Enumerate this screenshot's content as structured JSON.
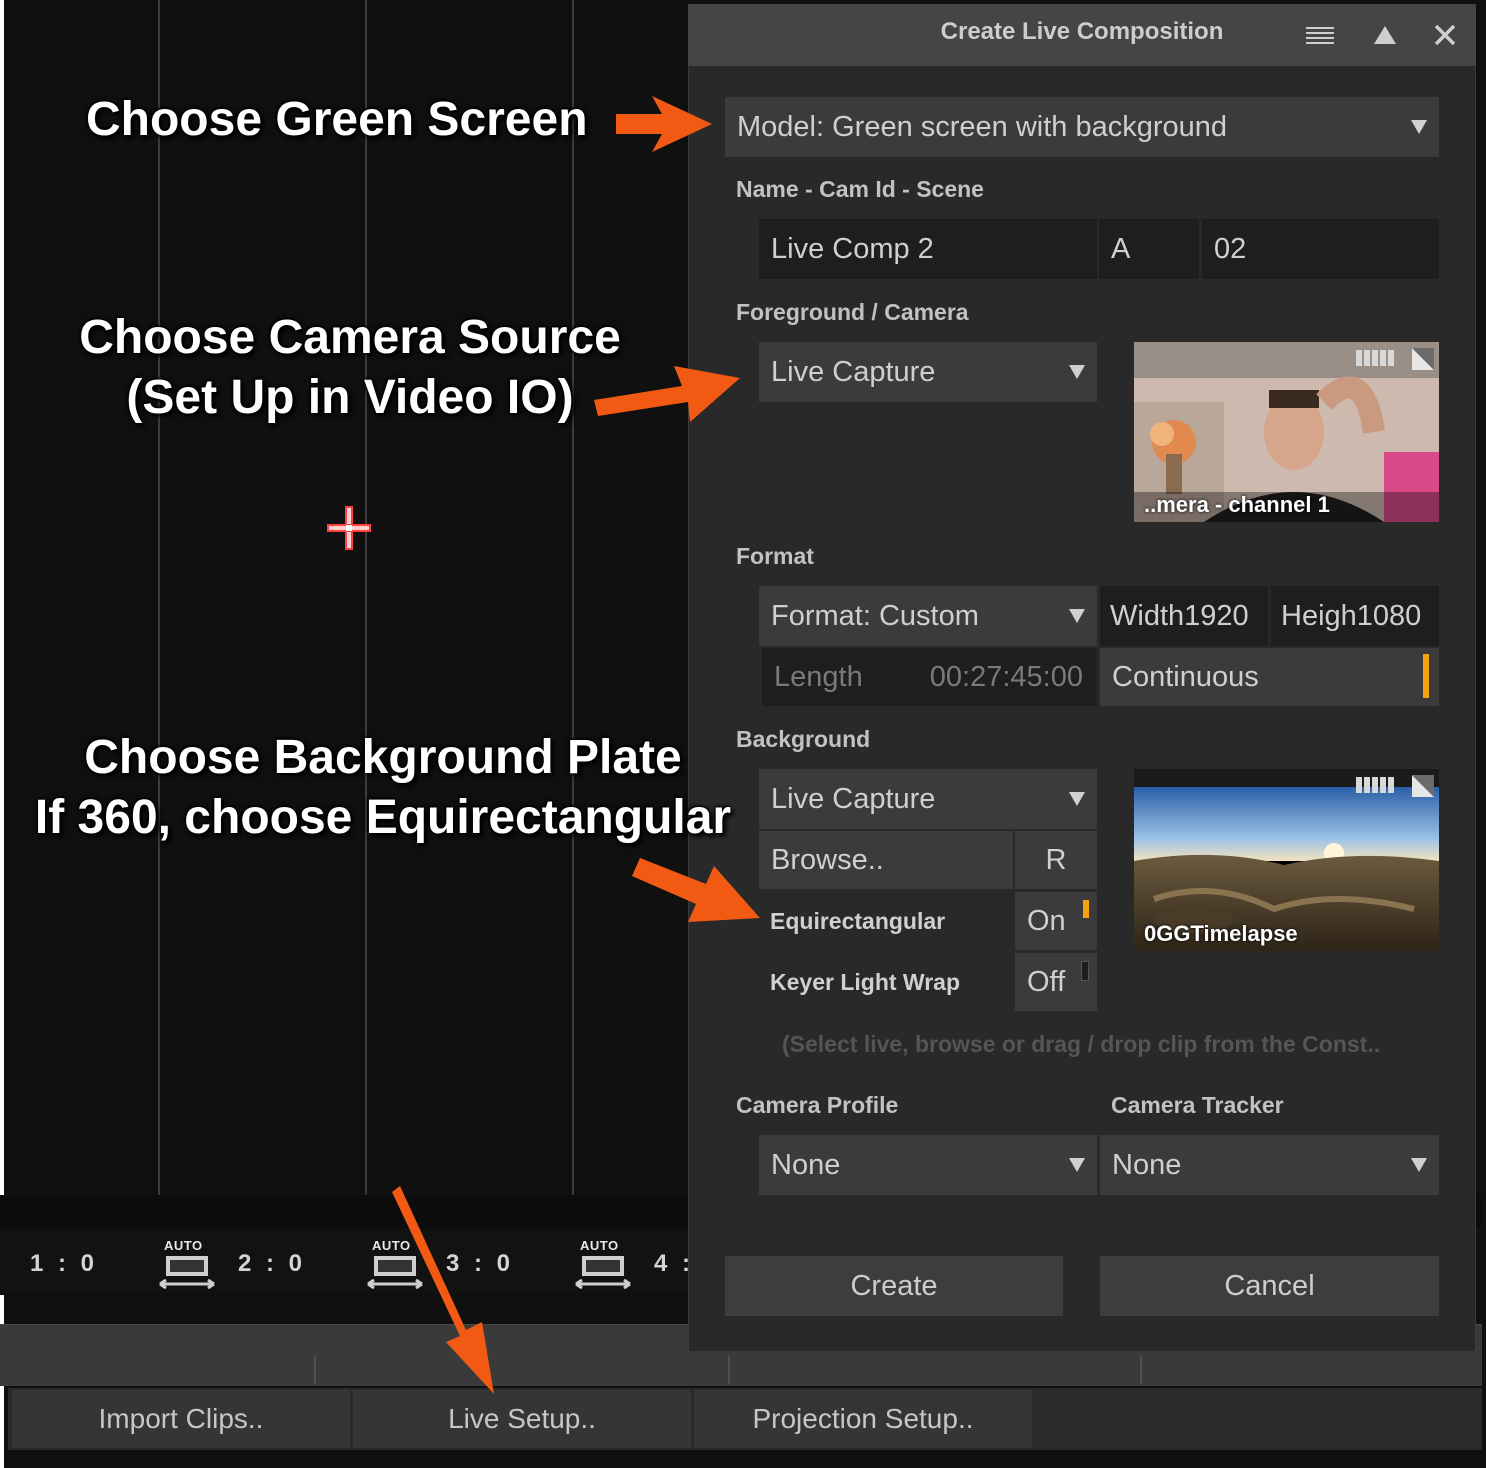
{
  "dialog": {
    "title": "Create Live Composition",
    "model_select": "Model: Green screen with background",
    "name_section": "Name - Cam Id - Scene",
    "name_value": "Live Comp 2",
    "cam_id_value": "A",
    "scene_value": "02",
    "foreground_section": "Foreground / Camera",
    "foreground_select": "Live Capture",
    "foreground_thumb_caption": "..mera - channel 1",
    "format_section": "Format",
    "format_select": "Format: Custom",
    "width_label": "Width",
    "width_value": "1920",
    "height_label": "Heigh",
    "height_value": "1080",
    "length_label": "Length",
    "length_value": "00:27:45:00",
    "continuous_label": "Continuous",
    "background_section": "Background",
    "background_select": "Live Capture",
    "browse_label": "Browse..",
    "r_label": "R",
    "equirect_label": "Equirectangular",
    "equirect_value": "On",
    "lightwrap_label": "Keyer Light Wrap",
    "lightwrap_value": "Off",
    "background_thumb_caption": "0GGTimelapse",
    "hint": "(Select live, browse or drag / drop clip from the Const..",
    "camera_profile_section": "Camera Profile",
    "camera_profile_select": "None",
    "camera_tracker_section": "Camera Tracker",
    "camera_tracker_select": "None",
    "create_label": "Create",
    "cancel_label": "Cancel",
    "accent_color": "#f6a10d"
  },
  "timeline": {
    "slots": [
      "1 : 0",
      "2 : 0",
      "3 : 0",
      "4 :"
    ],
    "auto_label": "AUTO"
  },
  "bottom_bar": {
    "import_label": "Import Clips..",
    "live_setup_label": "Live Setup..",
    "projection_label": "Projection Setup.."
  },
  "annotations": {
    "green_screen": "Choose Green Screen",
    "camera_source_line1": "Choose Camera Source",
    "camera_source_line2": "(Set Up in Video IO)",
    "background_line1": "Choose Background Plate",
    "background_line2": "If 360, choose Equirectangular",
    "arrow_color": "#f25a14"
  }
}
